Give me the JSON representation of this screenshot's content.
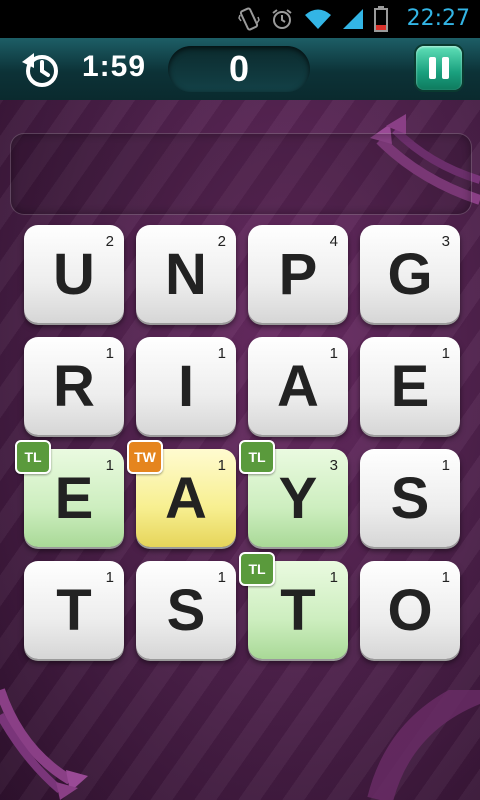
{
  "status_bar": {
    "time": "22:27",
    "icons": [
      "vibrate-icon",
      "alarm-icon",
      "wifi-icon",
      "signal-icon",
      "battery-low-icon"
    ],
    "battery_color": "#d9302a"
  },
  "game_bar": {
    "timer": "1:59",
    "score": "0",
    "undo_icon": "undo-clock-icon",
    "pause_icon": "pause-icon"
  },
  "word_panel": {
    "current_word": ""
  },
  "colors": {
    "tile_plain": "#ececec",
    "tile_triple_letter": "#cdeebf",
    "tile_triple_word": "#f7ef90",
    "badge_tl": "#5a9a3c",
    "badge_tw": "#e5851e",
    "accent": "#1aa07e"
  },
  "board": {
    "tiles": [
      {
        "letter": "U",
        "points": "2",
        "bonus": ""
      },
      {
        "letter": "N",
        "points": "2",
        "bonus": ""
      },
      {
        "letter": "P",
        "points": "4",
        "bonus": ""
      },
      {
        "letter": "G",
        "points": "3",
        "bonus": ""
      },
      {
        "letter": "R",
        "points": "1",
        "bonus": ""
      },
      {
        "letter": "I",
        "points": "1",
        "bonus": ""
      },
      {
        "letter": "A",
        "points": "1",
        "bonus": ""
      },
      {
        "letter": "E",
        "points": "1",
        "bonus": ""
      },
      {
        "letter": "E",
        "points": "1",
        "bonus": "TL"
      },
      {
        "letter": "A",
        "points": "1",
        "bonus": "TW"
      },
      {
        "letter": "Y",
        "points": "3",
        "bonus": "TL"
      },
      {
        "letter": "S",
        "points": "1",
        "bonus": ""
      },
      {
        "letter": "T",
        "points": "1",
        "bonus": ""
      },
      {
        "letter": "S",
        "points": "1",
        "bonus": ""
      },
      {
        "letter": "T",
        "points": "1",
        "bonus": "TL"
      },
      {
        "letter": "O",
        "points": "1",
        "bonus": ""
      }
    ]
  }
}
